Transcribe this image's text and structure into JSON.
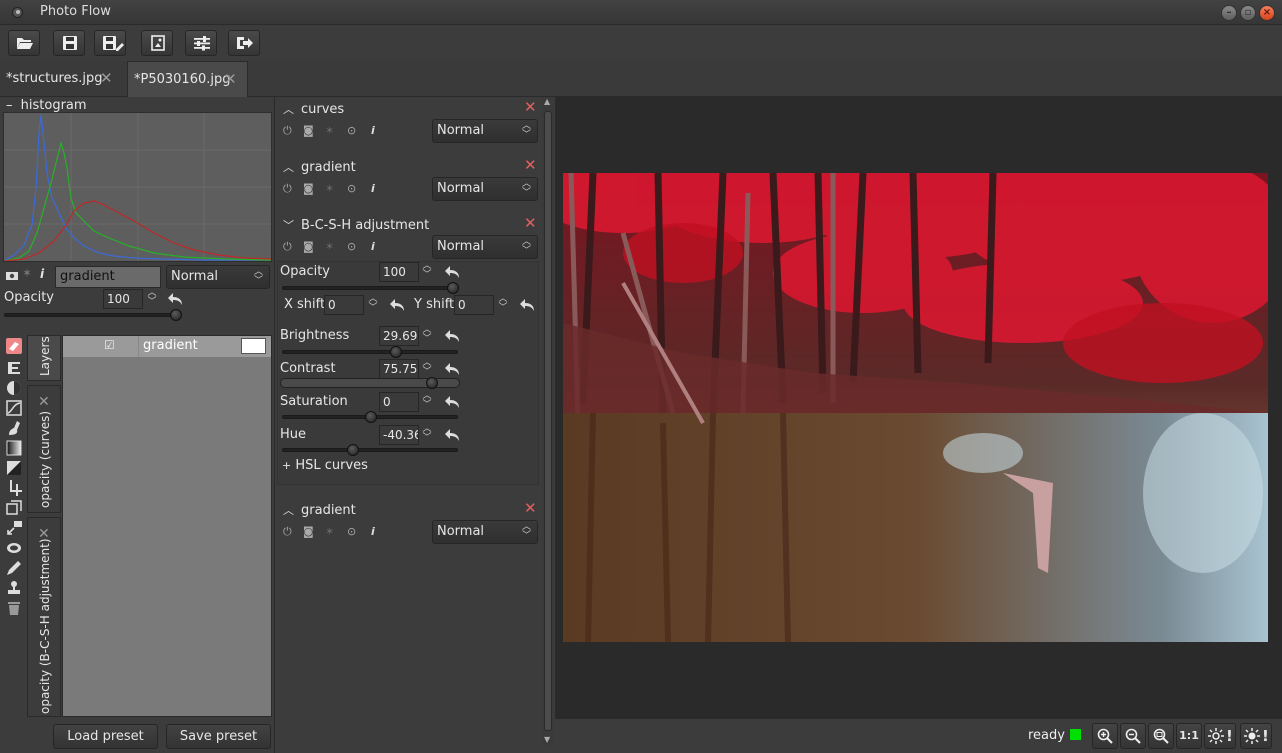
{
  "window": {
    "title": "Photo Flow"
  },
  "toolbar": {
    "buttons": [
      "open-icon",
      "save-icon",
      "save-as-icon",
      "export-icon",
      "settings-icon",
      "exit-icon"
    ]
  },
  "tabs": [
    {
      "label": "*structures.jpg",
      "active": false
    },
    {
      "label": "*P5030160.jpg",
      "active": true
    }
  ],
  "histogram": {
    "label": "histogram",
    "toggle": "–"
  },
  "layer_props": {
    "name": "gradient",
    "blend": "Normal",
    "opacity_label": "Opacity",
    "opacity_value": "100",
    "opacity_level": 1.0
  },
  "side_tabs": [
    "Layers",
    "opacity (curves)",
    "opacity (B-C-S-H adjustment)"
  ],
  "layers_list": [
    {
      "name": "gradient",
      "checked": true
    }
  ],
  "preset_buttons": {
    "load": "Load preset",
    "save": "Save preset"
  },
  "mid_layers": [
    {
      "title": "curves",
      "blend": "Normal",
      "expanded": false
    },
    {
      "title": "gradient",
      "blend": "Normal",
      "expanded": false
    },
    {
      "title": "B-C-S-H adjustment",
      "blend": "Normal",
      "expanded": true
    },
    {
      "title": "gradient",
      "blend": "Normal",
      "expanded": false
    }
  ],
  "bcsh": {
    "opacity": {
      "label": "Opacity",
      "value": "100",
      "level": 1.0
    },
    "x_shift": {
      "label": "X shift",
      "value": "0"
    },
    "y_shift": {
      "label": "Y shift",
      "value": "0"
    },
    "brightness": {
      "label": "Brightness",
      "value": "29.697",
      "level": 0.64
    },
    "contrast": {
      "label": "Contrast",
      "value": "75.757",
      "level": 0.87
    },
    "saturation": {
      "label": "Saturation",
      "value": "0",
      "level": 0.5
    },
    "hue": {
      "label": "Hue",
      "value": "-40.363",
      "level": 0.38
    },
    "hsl_curves": "HSL curves",
    "hsl_toggle": "+"
  },
  "status": {
    "text": "ready",
    "indicator_color": "#00e000",
    "zoom_buttons": [
      "zoom-in-icon",
      "zoom-out-icon",
      "zoom-fit-icon"
    ],
    "one_to_one": "1:1",
    "excl": "!"
  },
  "colors": {
    "bg": "#3c3c3c",
    "canvas": "#2a2a2a",
    "accent_close": "#e06060"
  }
}
